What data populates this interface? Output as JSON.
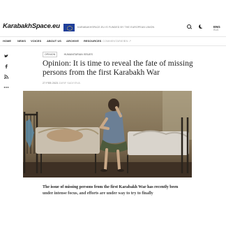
{
  "header": {
    "logo": "KarabakhSpace.eu",
    "eu_notice": "KARABAKHSPACE.EU IS FUNDED BY THE EUROPEAN UNION",
    "language": "ENG",
    "language_sub": "RUS"
  },
  "nav": {
    "items": [
      "HOME",
      "NEWS",
      "VOICES",
      "ABOUT US",
      "ARCHIVE",
      "RESOURCES",
      "COMMENTARIES"
    ],
    "extra": "EN  ↗"
  },
  "share": {
    "icons": [
      "twitter-icon",
      "facebook-icon",
      "rss-icon",
      "more-icon"
    ]
  },
  "article": {
    "tags": [
      "OPINION",
      "HUMANITARIAN ISSUES"
    ],
    "title": "Opinion: It is time to reveal the fate of missing persons from the first Karabakh War",
    "date": "27 FEB 2023",
    "author": "ZARIF SADIYEVA",
    "photo_alt": "A woman sitting on a bed in a sparse room",
    "lead": "The issue of missing persons from the first Karabakh War has recently been under intense focus, and efforts are under way to try to finally"
  },
  "colors": {
    "accent": "#1f3f9a",
    "text": "#222222",
    "photo_wall": "#8a7a60"
  }
}
